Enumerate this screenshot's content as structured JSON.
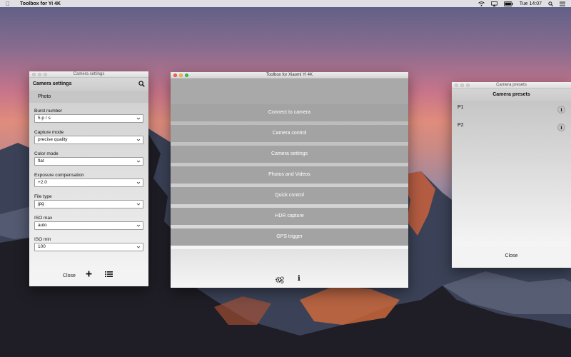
{
  "menubar": {
    "app_name": "Toolbox for Yi 4K",
    "clock": "Tue 14:07"
  },
  "settings_window": {
    "window_title": "Camera settings",
    "header": "Camera settings",
    "section": "Photo",
    "fields": [
      {
        "label": "Burst number",
        "value": "5 p / s"
      },
      {
        "label": "Capture mode",
        "value": "precise quality"
      },
      {
        "label": "Color mode",
        "value": "flat"
      },
      {
        "label": "Exposure compensation",
        "value": "+2.0"
      },
      {
        "label": "File type",
        "value": "jpg"
      },
      {
        "label": "ISO max",
        "value": "auto"
      },
      {
        "label": "ISO min",
        "value": "100"
      }
    ],
    "close_label": "Close"
  },
  "main_window": {
    "window_title": "Toolbox for Xiaomi Yi 4K",
    "buttons": [
      "Connect to camera",
      "Camera control",
      "Camera settings",
      "Photos and Videos",
      "Quick control",
      "HDR capture",
      "GPS trigger"
    ]
  },
  "presets_window": {
    "window_title": "Camera presets",
    "header": "Camera presets",
    "presets": [
      "P1",
      "P2"
    ],
    "info_glyph": "i",
    "close_label": "Close"
  },
  "icons": {
    "info_glyph": "i"
  }
}
